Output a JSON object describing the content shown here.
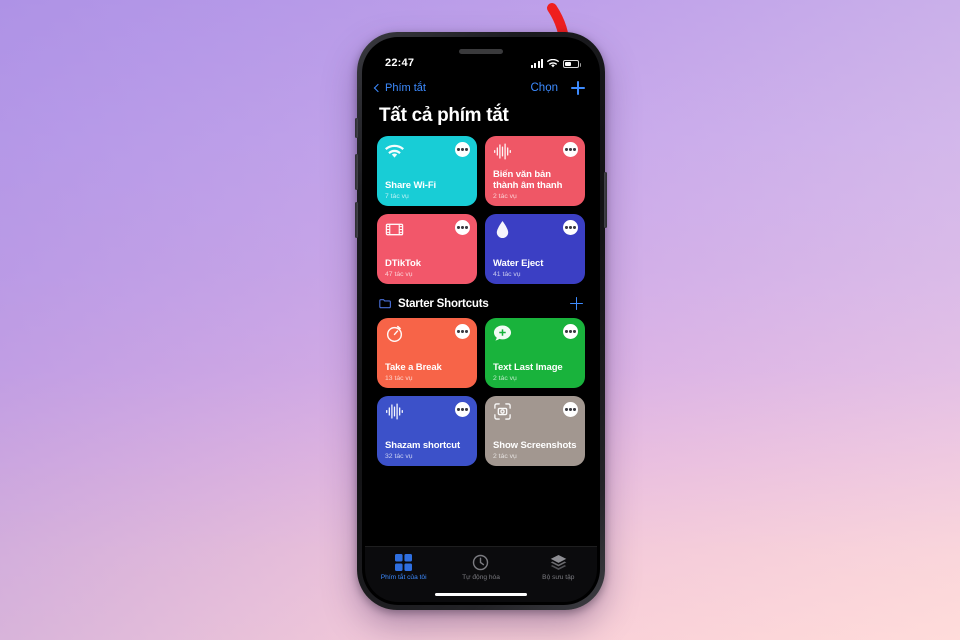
{
  "statusbar": {
    "time": "22:47",
    "signal_icon": "cellular-bars-icon",
    "wifi_icon": "wifi-icon",
    "battery_icon": "battery-icon"
  },
  "navbar": {
    "back_label": "Phím tắt",
    "choose_label": "Chọn",
    "add_icon": "plus-icon",
    "back_icon": "chevron-left-icon"
  },
  "page_title": "Tất cả phím tắt",
  "all_shortcuts": [
    {
      "title": "Share Wi-Fi",
      "subtitle": "7 tác vụ",
      "color": "#18cdd6",
      "icon": "wifi-icon"
    },
    {
      "title": "Biến văn bản thành âm thanh",
      "subtitle": "2 tác vụ",
      "color": "#ef5766",
      "icon": "waveform-icon"
    },
    {
      "title": "DTikTok",
      "subtitle": "47 tác vụ",
      "color": "#f2576a",
      "icon": "film-icon"
    },
    {
      "title": "Water Eject",
      "subtitle": "41 tác vụ",
      "color": "#3b3fc4",
      "icon": "water-drop-icon"
    }
  ],
  "starter_section": {
    "title": "Starter Shortcuts",
    "folder_icon": "folder-icon",
    "add_icon": "plus-icon"
  },
  "starter_shortcuts": [
    {
      "title": "Take a Break",
      "subtitle": "13 tác vụ",
      "color": "#f76448",
      "icon": "timer-icon"
    },
    {
      "title": "Text Last Image",
      "subtitle": "2 tác vụ",
      "color": "#19b33c",
      "icon": "message-plus-icon"
    },
    {
      "title": "Shazam shortcut",
      "subtitle": "32 tác vụ",
      "color": "#3c51c9",
      "icon": "waveform-icon"
    },
    {
      "title": "Show Screenshots",
      "subtitle": "2 tác vụ",
      "color": "#a29790",
      "icon": "screenshot-icon"
    }
  ],
  "tabbar": [
    {
      "label": "Phím tắt của tôi",
      "icon": "grid-squares-icon",
      "active": true
    },
    {
      "label": "Tự động hóa",
      "icon": "clock-icon",
      "active": false
    },
    {
      "label": "Bộ sưu tập",
      "icon": "layers-icon",
      "active": false
    }
  ],
  "annotation": {
    "arrow_color": "#f01f1f",
    "arrow_icon": "curved-down-arrow-icon"
  },
  "accent_color": "#3d8bff"
}
